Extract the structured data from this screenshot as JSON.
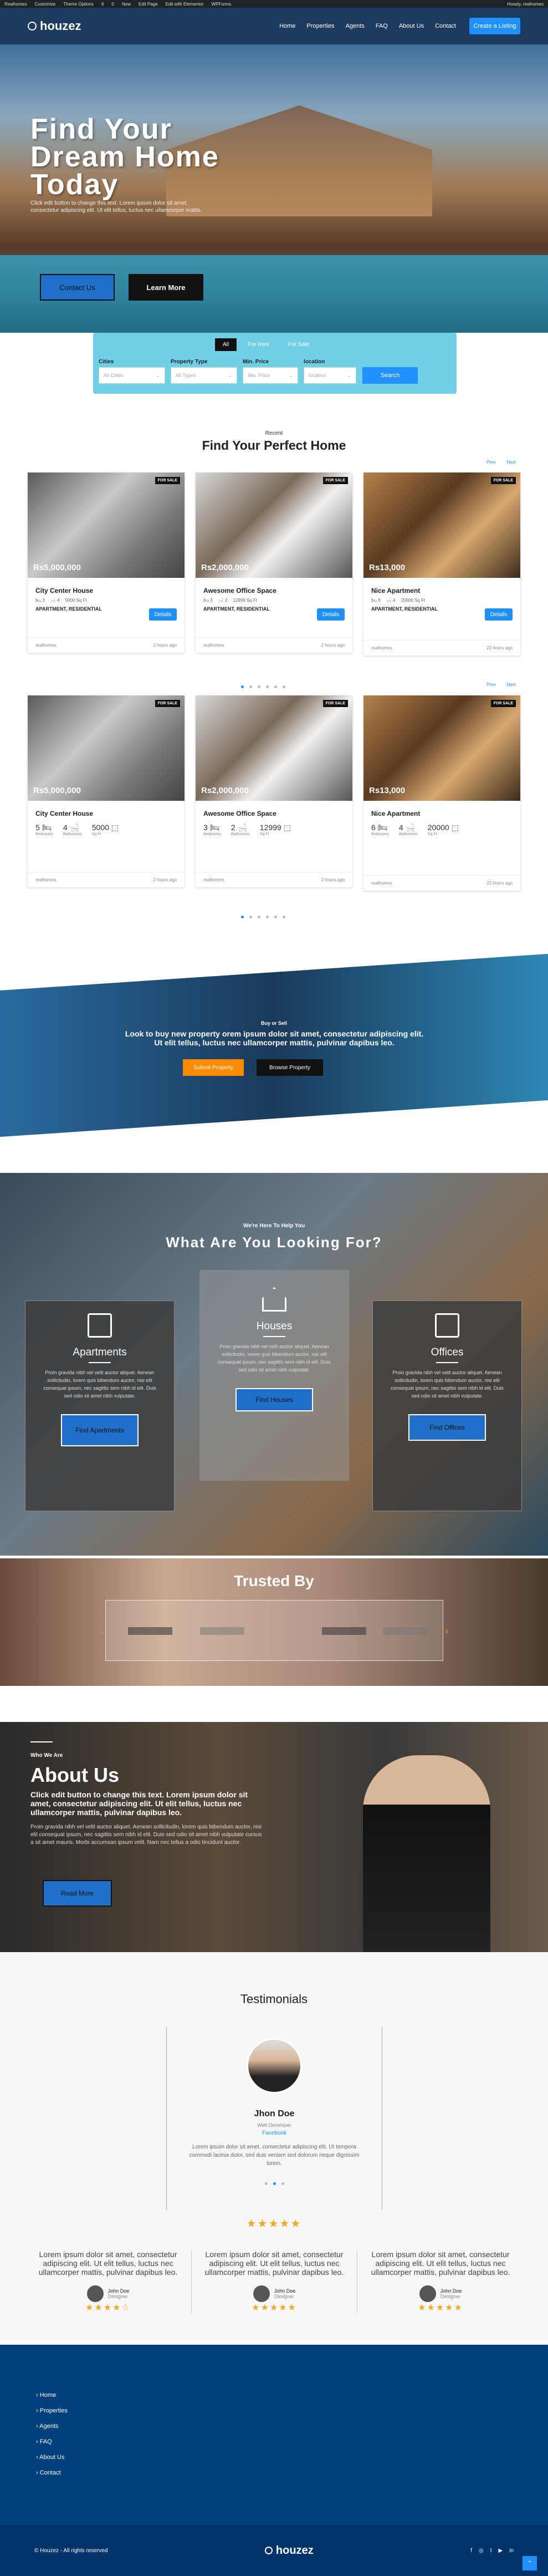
{
  "adminbar": {
    "items": [
      "Realhomes",
      "Customize",
      "Theme Options",
      "6",
      "0",
      "New",
      "Edit Page",
      "Edit with Elementor",
      "WPForms"
    ],
    "howdy": "Howdy, realhomes"
  },
  "header": {
    "logo": "houzez",
    "nav": [
      "Home",
      "Properties",
      "Agents",
      "FAQ",
      "About Us",
      "Contact"
    ],
    "cta": "Create a Listing"
  },
  "hero": {
    "title": "Find Your Dream Home Today",
    "subtitle": "Click edit button to change this text. Lorem ipsum dolor sit amet, consectetur adipiscing elit. Ut elit tellus, luctus nec ullamcorper mattis.",
    "btn_primary": "Contact Us",
    "btn_secondary": "Learn More"
  },
  "search": {
    "tabs": [
      "All",
      "For Rent",
      "For Sale"
    ],
    "fields": [
      {
        "label": "Cities",
        "placeholder": "All Cities"
      },
      {
        "label": "Property Type",
        "placeholder": "All Types"
      },
      {
        "label": "Min. Price",
        "placeholder": "Min. Price"
      },
      {
        "label": "location",
        "placeholder": "location"
      }
    ],
    "button": "Search"
  },
  "listings": {
    "kicker": "Recent",
    "title": "Find Your Perfect Home",
    "prev": "Prev",
    "next": "Next",
    "row1": [
      {
        "tag": "FOR SALE",
        "price": "Rs5,000,000",
        "name": "City Center House",
        "beds": "3",
        "baths": "4",
        "area": "5000 Sq Ft",
        "type": "APARTMENT, RESIDENTIAL",
        "details": "Details",
        "agent": "realhomes",
        "time": "2 hours ago"
      },
      {
        "tag": "FOR SALE",
        "price": "Rs2,000,000",
        "name": "Awesome Office Space",
        "beds": "3",
        "baths": "2",
        "area": "12999 Sq Ft",
        "type": "APARTMENT, RESIDENTIAL",
        "details": "Details",
        "agent": "realhomes",
        "time": "2 hours ago"
      },
      {
        "tag": "FOR SALE",
        "price": "Rs13,000",
        "name": "Nice Apartment",
        "beds": "6",
        "baths": "4",
        "area": "20000 Sq Ft",
        "type": "APARTMENT, RESIDENTIAL",
        "details": "Details",
        "agent": "realhomes",
        "time": "22 hours ago"
      }
    ],
    "row2": [
      {
        "tag": "FOR SALE",
        "price": "Rs5,000,000",
        "name": "City Center House",
        "beds": "5",
        "baths": "4",
        "area": "5000",
        "beds_label": "Bedrooms",
        "baths_label": "Bathrooms",
        "area_label": "Sq Ft",
        "agent": "realhomes",
        "time": "2 hours ago"
      },
      {
        "tag": "FOR SALE",
        "price": "Rs2,000,000",
        "name": "Awesome Office Space",
        "beds": "3",
        "baths": "2",
        "area": "12999",
        "beds_label": "Bedrooms",
        "baths_label": "Bathrooms",
        "area_label": "Sq Ft",
        "agent": "realhomes",
        "time": "2 hours ago"
      },
      {
        "tag": "FOR SALE",
        "price": "Rs13,000",
        "name": "Nice Apartment",
        "beds": "6",
        "baths": "4",
        "area": "20000",
        "beds_label": "Bedrooms",
        "baths_label": "Bathrooms",
        "area_label": "Sq Ft",
        "agent": "realhomes",
        "time": "22 hours ago"
      }
    ]
  },
  "banner": {
    "kicker": "Buy or Sell",
    "text": "Look to buy new property orem ipsum dolor sit amet, consectetur adipiscing elit. Ut elit tellus, luctus nec ullamcorper mattis, pulvinar dapibus leo.",
    "btn1": "Submit Property",
    "btn2": "Browse Property"
  },
  "looking": {
    "kicker": "We're Here To Help You",
    "title": "What Are You Looking For?",
    "cards": [
      {
        "title": "Apartments",
        "text": "Proin gravida nibh vel velit auctor aliquet. Aenean sollicitudin, lorem quis bibendum auctor, nisi elit consequat ipsum, nec sagittis sem nibh id elit. Duis sed odio sit amet nibh vulputate.",
        "btn": "Find Apartments"
      },
      {
        "title": "Houses",
        "text": "Proin gravida nibh vel velit auctor aliquet. Aenean sollicitudin, lorem quis bibendum auctor, nisi elit consequat ipsum, nec sagittis sem nibh id elit. Duis sed odio sit amet nibh vulputate.",
        "btn": "Find Houses"
      },
      {
        "title": "Offices",
        "text": "Proin gravida nibh vel velit auctor aliquet. Aenean sollicitudin, lorem quis bibendum auctor, nisi elit consequat ipsum, nec sagittis sem nibh id elit. Duis sed odio sit amet nibh vulputate.",
        "btn": "Find Offices"
      }
    ]
  },
  "trusted": {
    "title": "Trusted By"
  },
  "about": {
    "kicker": "Who We Are",
    "title": "About Us",
    "lead": "Click edit button to change this text. Lorem ipsum dolor sit amet, consectetur adipiscing elit. Ut elit tellus, luctus nec ullamcorper mattis, pulvinar dapibus leo.",
    "text": "Proin gravida nibh vel velit auctor aliquet. Aenean sollicitudin, lorem quis bibendum auctor, nisi elit consequat ipsum, nec sagittis sem nibh id elit. Duis sed odio sit amet nibh vulputate cursus a sit amet mauris. Morbi accumsan ipsum velit. Nam nec tellus a odio tincidunt auctor.",
    "btn": "Read More"
  },
  "testimonials": {
    "title": "Testimonials",
    "name": "Jhon Doe",
    "role": "Web Developer",
    "company": "Facebook",
    "quote": "Lorem ipsum dolor sit amet, consectetur adipiscing elit. Ut tempora commodi lacinia dolor, sed duis veniam sed dolorum neque dignissim lorem.",
    "cols": [
      {
        "text": "Lorem ipsum dolor sit amet, consectetur adipiscing elit. Ut elit tellus, luctus nec ullamcorper mattis, pulvinar dapibus leo.",
        "name": "John Doe",
        "role": "Designer",
        "rating": 4.5
      },
      {
        "text": "Lorem ipsum dolor sit amet, consectetur adipiscing elit. Ut elit tellus, luctus nec ullamcorper mattis, pulvinar dapibus leo.",
        "name": "John Doe",
        "role": "Designer",
        "rating": 5
      },
      {
        "text": "Lorem ipsum dolor sit amet, consectetur adipiscing elit. Ut elit tellus, luctus nec ullamcorper mattis, pulvinar dapibus leo.",
        "name": "John Doe",
        "role": "Designer",
        "rating": 5
      }
    ]
  },
  "footer": {
    "links": [
      "Home",
      "Properties",
      "Agents",
      "FAQ",
      "About Us",
      "Contact"
    ],
    "copyright": "© Houzez - All rights reserved",
    "logo": "houzez"
  }
}
